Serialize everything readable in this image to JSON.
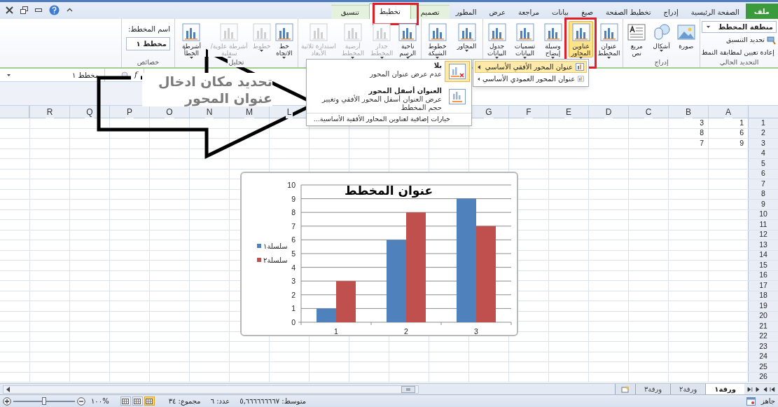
{
  "tabs": [
    {
      "label": "ملف",
      "kind": "file",
      "selected": false
    },
    {
      "label": "الصفحة الرئيسية",
      "kind": "tab",
      "selected": false
    },
    {
      "label": "إدراج",
      "kind": "tab",
      "selected": false
    },
    {
      "label": "تخطيط الصفحة",
      "kind": "tab",
      "selected": false
    },
    {
      "label": "صيغ",
      "kind": "tab",
      "selected": false
    },
    {
      "label": "بيانات",
      "kind": "tab",
      "selected": false
    },
    {
      "label": "مراجعة",
      "kind": "tab",
      "selected": false
    },
    {
      "label": "عرض",
      "kind": "tab",
      "selected": false
    },
    {
      "label": "المطور",
      "kind": "tab",
      "selected": false
    },
    {
      "label": "تصميم",
      "kind": "contextual",
      "selected": false
    },
    {
      "label": "تخطيط",
      "kind": "contextual",
      "selected": true
    },
    {
      "label": "تنسيق",
      "kind": "contextual",
      "selected": false
    }
  ],
  "ribbon": {
    "current_selection": {
      "label": "التحديد الحالي",
      "dropdown": "منطقة المخطط",
      "buttons": [
        "تحديد التنسيق",
        "إعادة تعيين لمطابقة النمط"
      ]
    },
    "groups": [
      {
        "label": "إدراج",
        "buttons": [
          {
            "label": "صورة",
            "dropdown": false,
            "disabled": false,
            "selected": false
          },
          {
            "label": "أشكال",
            "dropdown": true,
            "disabled": false,
            "selected": false
          },
          {
            "label": "مربع نص",
            "dropdown": false,
            "disabled": false,
            "selected": false
          }
        ]
      },
      {
        "buttons": [
          {
            "label": "عنوان المخطط",
            "dropdown": true,
            "disabled": false,
            "selected": false
          },
          {
            "label": "عناوين المحاور",
            "dropdown": true,
            "disabled": false,
            "selected": true
          },
          {
            "label": "وسيلة إيضاح",
            "dropdown": true,
            "disabled": false,
            "selected": false
          },
          {
            "label": "تسميات البيانات",
            "dropdown": true,
            "disabled": false,
            "selected": false
          },
          {
            "label": "جدول البيانات",
            "dropdown": true,
            "disabled": false,
            "selected": false
          }
        ]
      },
      {
        "buttons": [
          {
            "label": "المحاور",
            "dropdown": true,
            "disabled": false,
            "selected": false
          },
          {
            "label": "خطوط الشبكة",
            "dropdown": true,
            "disabled": false,
            "selected": false
          }
        ]
      },
      {
        "buttons": [
          {
            "label": "ناحية الرسم",
            "dropdown": true,
            "disabled": false,
            "selected": false
          },
          {
            "label": "جدار المخطط",
            "dropdown": true,
            "disabled": true,
            "selected": false
          },
          {
            "label": "أرضية المخطط",
            "dropdown": true,
            "disabled": true,
            "selected": false
          },
          {
            "label": "استدارة ثلاثية الأبعاد",
            "dropdown": false,
            "disabled": true,
            "selected": false
          }
        ]
      },
      {
        "label": "تحليل",
        "buttons": [
          {
            "label": "خط الاتجاه",
            "dropdown": true,
            "disabled": false,
            "selected": false
          },
          {
            "label": "خطوط",
            "dropdown": true,
            "disabled": true,
            "selected": false
          },
          {
            "label": "أشرطة علوية/سفلية",
            "dropdown": true,
            "disabled": true,
            "selected": false
          },
          {
            "label": "أشرطة الخطأ",
            "dropdown": true,
            "disabled": false,
            "selected": false
          }
        ]
      }
    ],
    "properties": {
      "label": "خصائص",
      "name_label": "اسم المخطط:",
      "name_value": "مخطط ١"
    }
  },
  "formula_bar": {
    "name_box": "مخطط ١",
    "function_symbol": "f"
  },
  "annotation": "تحديد مكان ادخال عنوان المحور",
  "axis_titles_menu": [
    {
      "label": "عنوان المحور الأفقي الأساسي",
      "selected": true
    },
    {
      "label": "عنوان المحور العمودي الأساسي",
      "selected": false
    }
  ],
  "horizontal_title_menu": {
    "items": [
      {
        "title": "بلا",
        "description": "عدم عرض عنوان المحور",
        "selected": true
      },
      {
        "title": "العنوان أسفل المحور",
        "description": "عرض العنوان أسفل المحور الأفقي وتغيير حجم المخطط",
        "selected": false
      }
    ],
    "more_options": "خيارات إضافية لعناوين المحاور الأفقية الأساسية..."
  },
  "columns_right": [
    "A",
    "B",
    "C",
    "D",
    "E",
    "F",
    "G"
  ],
  "columns_left": [
    "L",
    "M",
    "N",
    "O",
    "P",
    "Q",
    "R"
  ],
  "rows": [
    {
      "number": "1",
      "cells": [
        "1",
        "3"
      ]
    },
    {
      "number": "2",
      "cells": [
        "6",
        "8"
      ]
    },
    {
      "number": "3",
      "cells": [
        "9",
        "7"
      ]
    },
    {
      "number": "4"
    },
    {
      "number": "5"
    },
    {
      "number": "6"
    },
    {
      "number": "7"
    },
    {
      "number": "8"
    },
    {
      "number": "9"
    },
    {
      "number": "10"
    },
    {
      "number": "11"
    },
    {
      "number": "12"
    },
    {
      "number": "13"
    },
    {
      "number": "14"
    },
    {
      "number": "15"
    },
    {
      "number": "16"
    },
    {
      "number": "17"
    },
    {
      "number": "18"
    },
    {
      "number": "19"
    },
    {
      "number": "20"
    },
    {
      "number": "21"
    },
    {
      "number": "22"
    },
    {
      "number": "23"
    },
    {
      "number": "24"
    },
    {
      "number": "25"
    },
    {
      "number": "26"
    }
  ],
  "chart": {
    "chart_data": {
      "type": "bar",
      "title": "عنوان المخطط",
      "categories": [
        "1",
        "2",
        "3"
      ],
      "series": [
        {
          "name": "سلسلة١",
          "color": "#4f81bd",
          "values": [
            1,
            6,
            9
          ]
        },
        {
          "name": "سلسلة٢",
          "color": "#c0504d",
          "values": [
            3,
            8,
            7
          ]
        }
      ],
      "ylim": [
        0,
        10
      ],
      "grid": true,
      "legend": "left",
      "yticks": [
        0,
        1,
        2,
        3,
        4,
        5,
        6,
        7,
        8,
        9,
        10
      ]
    }
  },
  "sheet_tabs": [
    {
      "label": "ورقة١",
      "selected": true
    },
    {
      "label": "ورقة٢",
      "selected": false
    },
    {
      "label": "ورقة٣",
      "selected": false
    }
  ],
  "status_bar": {
    "ready": "جاهز",
    "stats": [
      "متوسط: ٥,٦٦٦٦٦٦٦٦٧",
      "عدد: ٦",
      "مجموع: ٣٤"
    ],
    "views": [
      {
        "selected": true
      },
      {
        "selected": false
      },
      {
        "selected": false
      }
    ],
    "zoom": {
      "label": "%١٠٠",
      "level": 0.5
    }
  }
}
